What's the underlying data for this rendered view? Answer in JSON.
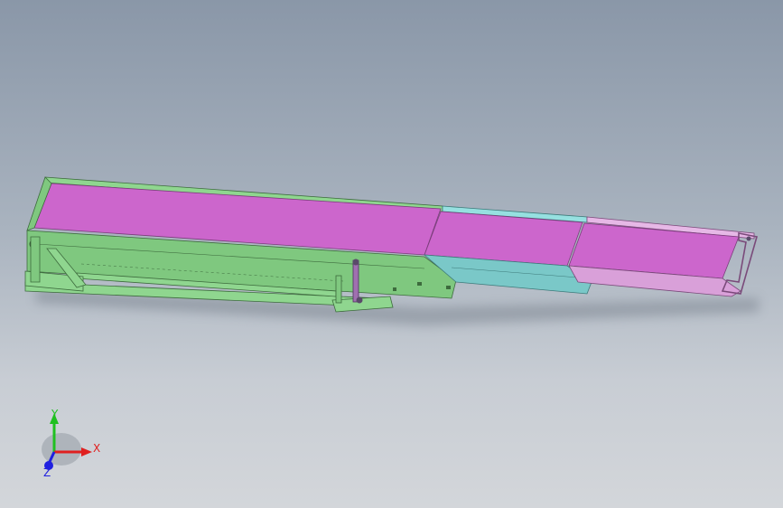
{
  "viewport": {
    "background_top": "#8a97a8",
    "background_bottom": "#d3d6da"
  },
  "model": {
    "belt_color": "#cc66cc",
    "frame_color": "#7fc87f",
    "mid_section_color": "#7ac8c8",
    "end_section_color": "#d9a0d9"
  },
  "triad": {
    "x_label": "X",
    "y_label": "Y",
    "z_label": "Z",
    "x_color": "#e02020",
    "y_color": "#20c020",
    "z_color": "#2020e0"
  }
}
